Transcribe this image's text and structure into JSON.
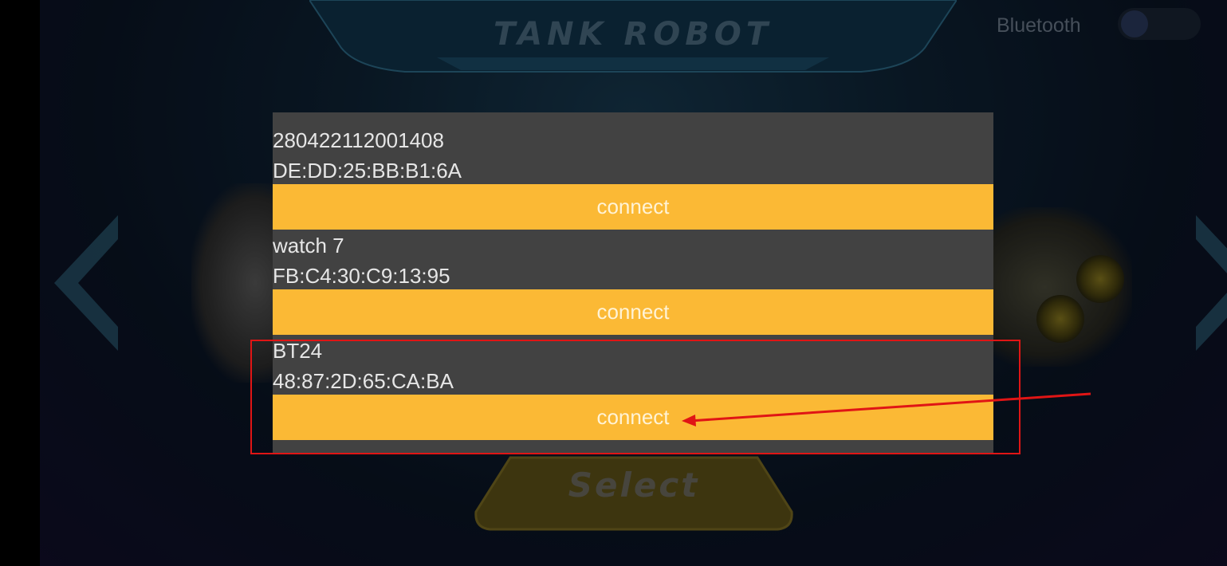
{
  "app": {
    "title": "TANK ROBOT"
  },
  "bluetooth": {
    "label": "Bluetooth",
    "enabled": false
  },
  "select_button": {
    "label": "Select"
  },
  "devices": [
    {
      "name": "280422112001408",
      "address": "DE:DD:25:BB:B1:6A",
      "action": "connect"
    },
    {
      "name": "watch 7",
      "address": "FB:C4:30:C9:13:95",
      "action": "connect"
    },
    {
      "name": "BT24",
      "address": "48:87:2D:65:CA:BA",
      "action": "connect"
    }
  ],
  "colors": {
    "connect_button": "#fbb935",
    "dialog_bg": "#424242",
    "annotation": "#e01515"
  }
}
